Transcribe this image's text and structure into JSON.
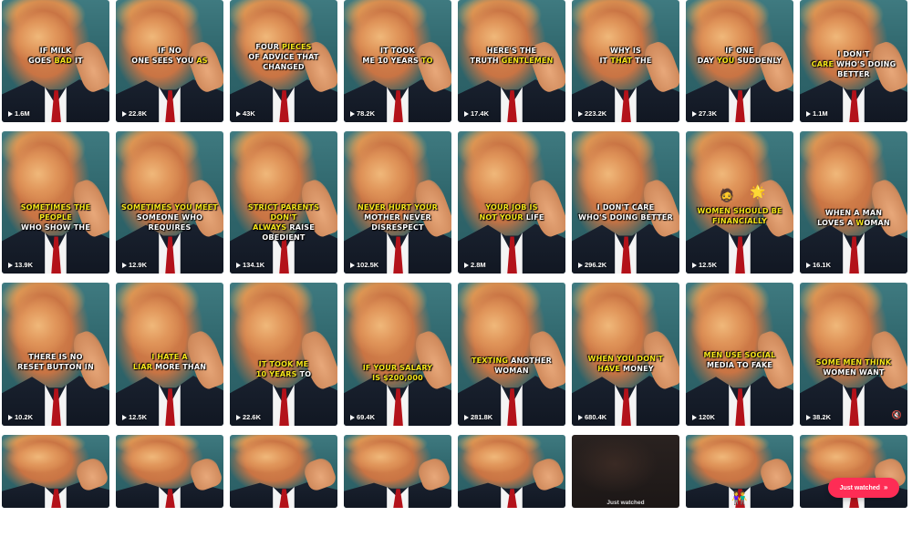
{
  "videos": [
    {
      "caption": [
        [
          "IF MILK",
          ""
        ],
        [
          "GOES ",
          "BAD",
          " IT"
        ]
      ],
      "views": "1.6M"
    },
    {
      "caption": [
        [
          "IF NO",
          ""
        ],
        [
          "ONE SEES YOU ",
          "AS",
          ""
        ]
      ],
      "views": "22.8K"
    },
    {
      "caption": [
        [
          "FOUR ",
          "PIECES",
          ""
        ],
        [
          "OF ADVICE THAT",
          ""
        ],
        [
          "CHANGED",
          ""
        ]
      ],
      "views": "43K"
    },
    {
      "caption": [
        [
          "IT TOOK",
          ""
        ],
        [
          "ME 10 YEARS ",
          "TO",
          ""
        ]
      ],
      "views": "78.2K"
    },
    {
      "caption": [
        [
          "HERE'S THE",
          ""
        ],
        [
          "TRUTH ",
          "GENTLEMEN",
          ""
        ]
      ],
      "views": "17.4K"
    },
    {
      "caption": [
        [
          "WHY IS",
          ""
        ],
        [
          "IT ",
          "THAT",
          " THE"
        ]
      ],
      "views": "223.2K"
    },
    {
      "caption": [
        [
          "IF ONE",
          ""
        ],
        [
          "DAY ",
          "YOU",
          " SUDDENLY"
        ]
      ],
      "views": "27.3K"
    },
    {
      "caption": [
        [
          "I DON'T",
          ""
        ],
        [
          "",
          "CARE",
          " WHO'S DOING"
        ],
        [
          "BETTER",
          ""
        ]
      ],
      "views": "1.1M"
    },
    {
      "caption": [
        [
          "",
          "SOMETIMES THE PEOPLE",
          ""
        ],
        [
          "WHO SHOW THE",
          ""
        ]
      ],
      "views": "13.9K"
    },
    {
      "caption": [
        [
          "",
          "SOMETIMES YOU MEET",
          ""
        ],
        [
          "SOMEONE WHO REQUIRES",
          ""
        ]
      ],
      "views": "12.9K"
    },
    {
      "caption": [
        [
          "",
          "STRICT PARENTS DON'T",
          ""
        ],
        [
          "",
          "ALWAYS",
          " RAISE OBEDIENT"
        ]
      ],
      "views": "134.1K"
    },
    {
      "caption": [
        [
          "",
          "NEVER HURT YOUR",
          ""
        ],
        [
          "MOTHER NEVER",
          ""
        ],
        [
          "DISRESPECT",
          ""
        ]
      ],
      "views": "102.5K"
    },
    {
      "caption": [
        [
          "",
          "YOUR JOB IS",
          ""
        ],
        [
          "",
          "NOT YOUR",
          " LIFE"
        ]
      ],
      "views": "2.8M"
    },
    {
      "caption": [
        [
          "I DON'T CARE",
          ""
        ],
        [
          "WHO'S DOING BETTER",
          ""
        ]
      ],
      "views": "296.2K"
    },
    {
      "caption": [
        [
          "",
          "WOMEN SHOULD BE",
          ""
        ],
        [
          "",
          "FINANCIALLY",
          ""
        ]
      ],
      "views": "12.5K",
      "emoji": [
        "🧔",
        "🌟"
      ]
    },
    {
      "caption": [
        [
          "WHEN A MAN",
          ""
        ],
        [
          "LOVES A ",
          "W",
          "OMAN"
        ]
      ],
      "views": "16.1K"
    },
    {
      "caption": [
        [
          "THERE IS NO",
          ""
        ],
        [
          "RESET BUTTON IN",
          ""
        ]
      ],
      "views": "10.2K"
    },
    {
      "caption": [
        [
          "",
          "I HATE A",
          ""
        ],
        [
          "",
          "LIAR",
          " MORE THAN"
        ]
      ],
      "views": "12.5K"
    },
    {
      "caption": [
        [
          "",
          "IT TOOK ME",
          ""
        ],
        [
          "",
          "10 YEARS",
          " TO"
        ]
      ],
      "views": "22.6K"
    },
    {
      "caption": [
        [
          "",
          "IF YOUR SALARY",
          ""
        ],
        [
          "",
          "IS $200,000",
          ""
        ]
      ],
      "views": "69.4K"
    },
    {
      "caption": [
        [
          "",
          "TEXTING",
          " ANOTHER"
        ],
        [
          "WOMAN",
          ""
        ]
      ],
      "views": "281.8K"
    },
    {
      "caption": [
        [
          "",
          "WHEN YOU DON'T",
          ""
        ],
        [
          "",
          "HAVE",
          " MONEY"
        ]
      ],
      "views": "680.4K"
    },
    {
      "caption": [
        [
          "",
          "MEN USE SOCIAL",
          ""
        ],
        [
          "MEDIA TO FAKE",
          ""
        ]
      ],
      "views": "120K"
    },
    {
      "caption": [
        [
          "",
          "SOME MEN THINK",
          ""
        ],
        [
          "WOMEN WANT",
          ""
        ]
      ],
      "views": "38.2K"
    },
    {
      "caption": [],
      "views": ""
    },
    {
      "caption": [],
      "views": ""
    },
    {
      "caption": [],
      "views": ""
    },
    {
      "caption": [],
      "views": ""
    },
    {
      "caption": [],
      "views": ""
    },
    {
      "caption": [],
      "views": "",
      "label": "Just watched"
    },
    {
      "caption": [],
      "views": "",
      "emoji": [
        "👫"
      ]
    },
    {
      "caption": [],
      "views": ""
    }
  ],
  "mute_icon": "🔇",
  "just_watched_button": {
    "label": "Just watched",
    "icon": "double-chevron-down-icon"
  }
}
